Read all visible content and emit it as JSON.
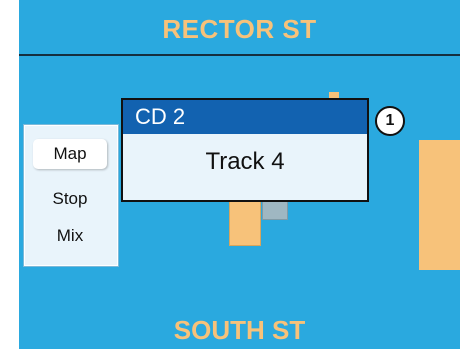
{
  "map": {
    "top_street": "RECTOR ST",
    "bottom_street": "SOUTH ST"
  },
  "side_menu": {
    "items": [
      {
        "label": "Map",
        "selected": true
      },
      {
        "label": "Stop",
        "selected": false
      },
      {
        "label": "Mix",
        "selected": false
      }
    ]
  },
  "popup": {
    "source": "CD 2",
    "track": "Track 4"
  },
  "callout": {
    "number": "1"
  },
  "colors": {
    "background": "#2aa9df",
    "street_text": "#f7c27a",
    "popup_header": "#1262b0"
  }
}
